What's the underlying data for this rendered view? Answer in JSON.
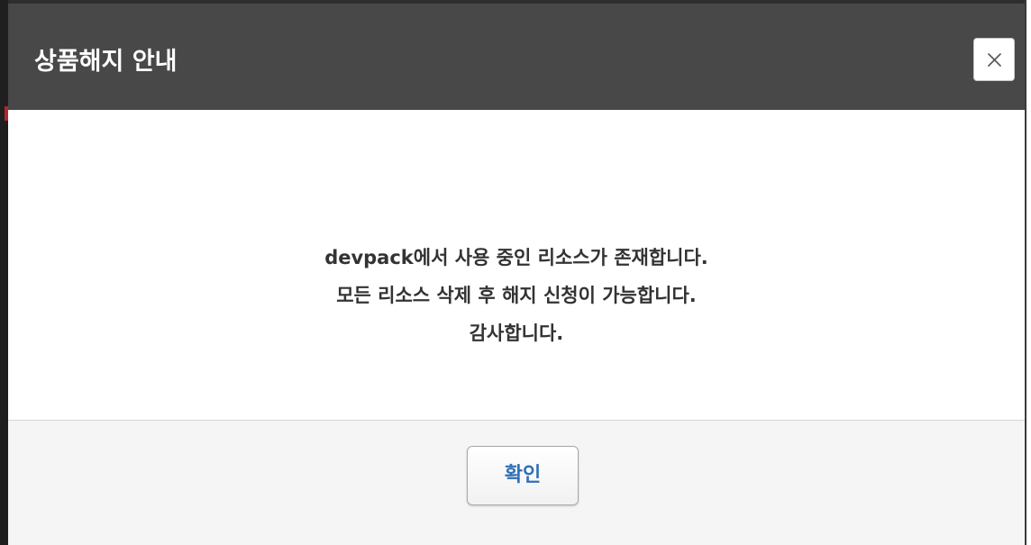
{
  "dialog": {
    "title": "상품해지 안내",
    "close_icon": "close-icon",
    "message_lines": [
      "devpack에서 사용 중인 리소스가 존재합니다.",
      "모든 리소스 삭제 후 해지 신청이 가능합니다.",
      "감사합니다."
    ],
    "confirm_label": "확인"
  },
  "colors": {
    "header_bg": "#484848",
    "title_text": "#ffffff",
    "message_text": "#333333",
    "footer_bg": "#f5f5f5",
    "confirm_text": "#2f6fb5"
  }
}
